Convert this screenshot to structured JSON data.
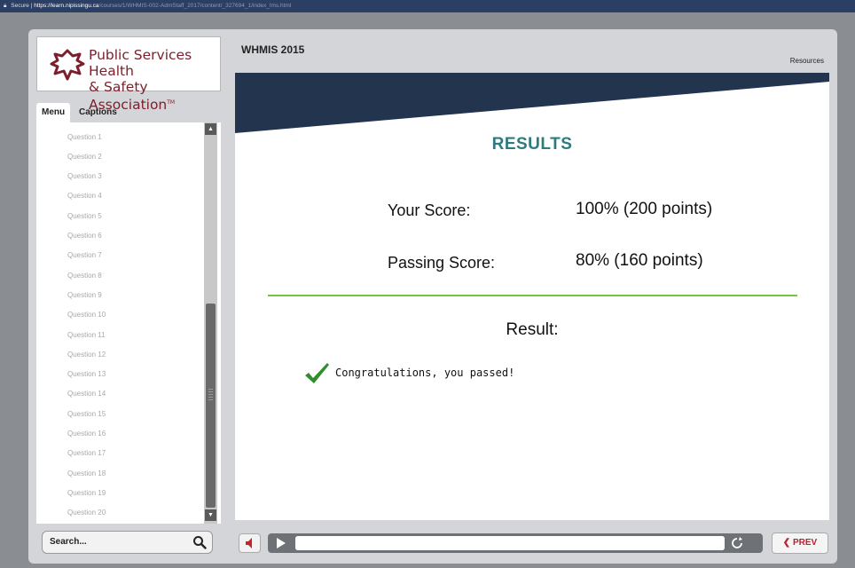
{
  "browser": {
    "secure_label": "Secure",
    "url_host": "https://learn.nipissingu.ca",
    "url_path": "/courses/1/WHMIS-002-AdmStaff_2017/content/_327694_1/index_lms.html"
  },
  "logo": {
    "line1": "Public Services Health",
    "line2": "& Safety Association",
    "trademark": "TM",
    "color": "#7a1f2b"
  },
  "sidebar": {
    "tabs": [
      "Menu",
      "Captions"
    ],
    "active_tab": "Menu",
    "items": [
      "Question 1",
      "Question 2",
      "Question 3",
      "Question 4",
      "Question 5",
      "Question 6",
      "Question 7",
      "Question 8",
      "Question 9",
      "Question 10",
      "Question 11",
      "Question 12",
      "Question 13",
      "Question 14",
      "Question 15",
      "Question 16",
      "Question 17",
      "Question 18",
      "Question 19",
      "Question 20"
    ],
    "search_label": "Search..."
  },
  "header": {
    "course_title": "WHMIS 2015",
    "resources_label": "Resources"
  },
  "slide": {
    "title": "RESULTS",
    "your_score_label": "Your Score:",
    "your_score_value": "100% (200 points)",
    "passing_score_label": "Passing Score:",
    "passing_score_value": "80% (160 points)",
    "result_label": "Result:",
    "result_message": "Congratulations, you passed!",
    "accent_color": "#2e7b7f",
    "banner_color": "#23344f",
    "divider_color": "#7ac143",
    "check_color": "#2f8f2f"
  },
  "controls": {
    "prev_label": "PREV",
    "prev_icon": "chevron-left-icon"
  }
}
